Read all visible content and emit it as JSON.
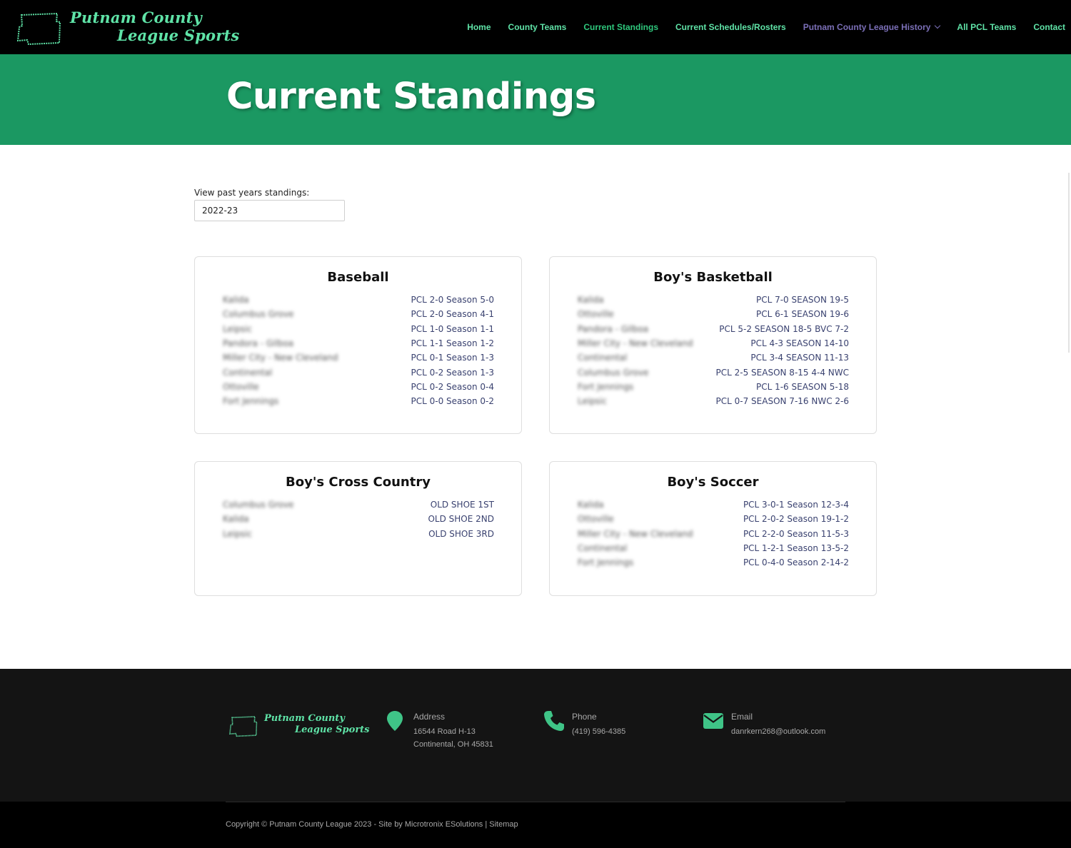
{
  "brand": {
    "line1": "Putnam County",
    "line2": "League Sports",
    "accent": "#5fe3a7",
    "map_icon": "county-outline-icon"
  },
  "nav": [
    {
      "label": "Home",
      "state": "default"
    },
    {
      "label": "County Teams",
      "state": "default"
    },
    {
      "label": "Current Standings",
      "state": "active"
    },
    {
      "label": "Current Schedules/Rosters",
      "state": "default"
    },
    {
      "label": "Putnam County League History",
      "state": "dropdown"
    },
    {
      "label": "All PCL Teams",
      "state": "default"
    },
    {
      "label": "Contact",
      "state": "default"
    }
  ],
  "hero": {
    "title": "Current Standings",
    "bg": "#1b9862"
  },
  "selector": {
    "label": "View past years standings:",
    "value": "2022-23"
  },
  "sports": [
    {
      "title": "Baseball",
      "rows": [
        {
          "team": "Kalida",
          "record": "PCL 2-0 Season 5-0"
        },
        {
          "team": "Columbus Grove",
          "record": "PCL 2-0 Season 4-1"
        },
        {
          "team": "Leipsic",
          "record": "PCL 1-0 Season 1-1"
        },
        {
          "team": "Pandora - Gilboa",
          "record": "PCL 1-1 Season 1-2"
        },
        {
          "team": "Miller City - New Cleveland",
          "record": "PCL 0-1 Season 1-3"
        },
        {
          "team": "Continental",
          "record": "PCL 0-2 Season 1-3"
        },
        {
          "team": "Ottoville",
          "record": "PCL 0-2 Season 0-4"
        },
        {
          "team": "Fort Jennings",
          "record": "PCL 0-0 Season 0-2"
        }
      ]
    },
    {
      "title": "Boy's Basketball",
      "rows": [
        {
          "team": "Kalida",
          "record": "PCL 7-0 SEASON 19-5"
        },
        {
          "team": "Ottoville",
          "record": "PCL 6-1 SEASON 19-6"
        },
        {
          "team": "Pandora - Gilboa",
          "record": "PCL 5-2 SEASON 18-5 BVC 7-2"
        },
        {
          "team": "Miller City - New Cleveland",
          "record": "PCL 4-3 SEASON 14-10"
        },
        {
          "team": "Continental",
          "record": "PCL 3-4 SEASON 11-13"
        },
        {
          "team": "Columbus Grove",
          "record": "PCL 2-5 SEASON 8-15 4-4 NWC"
        },
        {
          "team": "Fort Jennings",
          "record": "PCL 1-6 SEASON 5-18"
        },
        {
          "team": "Leipsic",
          "record": "PCL 0-7 SEASON 7-16 NWC 2-6"
        }
      ]
    },
    {
      "title": "Boy's Cross Country",
      "rows": [
        {
          "team": "Columbus Grove",
          "record": "OLD SHOE 1ST"
        },
        {
          "team": "Kalida",
          "record": "OLD SHOE 2ND"
        },
        {
          "team": "Leipsic",
          "record": "OLD SHOE 3RD"
        }
      ]
    },
    {
      "title": "Boy's Soccer",
      "rows": [
        {
          "team": "Kalida",
          "record": "PCL 3-0-1 Season 12-3-4"
        },
        {
          "team": "Ottoville",
          "record": "PCL 2-0-2 Season 19-1-2"
        },
        {
          "team": "Miller City - New Cleveland",
          "record": "PCL 2-2-0 Season 11-5-3"
        },
        {
          "team": "Continental",
          "record": "PCL 1-2-1 Season 13-5-2"
        },
        {
          "team": "Fort Jennings",
          "record": "PCL 0-4-0 Season 2-14-2"
        }
      ]
    }
  ],
  "footer": {
    "address": {
      "label": "Address",
      "line1": "16544 Road H-13",
      "line2": "Continental, OH 45831",
      "icon": "map-pin-icon"
    },
    "phone": {
      "label": "Phone",
      "value": "(419) 596-4385",
      "icon": "phone-icon"
    },
    "email": {
      "label": "Email",
      "value": "danrkern268@outlook.com",
      "icon": "envelope-icon"
    },
    "copyright": "Copyright © Putnam County League 2023 - Site by Microtronix ESolutions | Sitemap"
  }
}
